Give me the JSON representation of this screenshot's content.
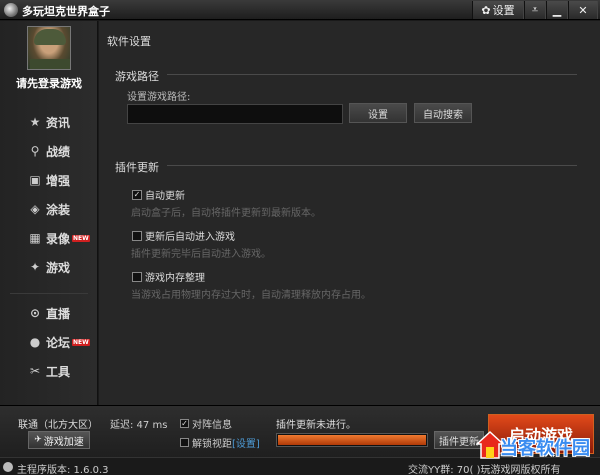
{
  "window": {
    "title": "多玩坦克世界盒子",
    "settings_label": "设置"
  },
  "sidebar": {
    "login_text": "请先登录游戏",
    "items": [
      {
        "label": "资讯",
        "icon": "star-icon",
        "glyph": "★",
        "new": false
      },
      {
        "label": "战绩",
        "icon": "search-icon",
        "glyph": "🔍",
        "new": false
      },
      {
        "label": "增强",
        "icon": "toolbox-icon",
        "glyph": "▣",
        "new": false
      },
      {
        "label": "涂装",
        "icon": "paint-icon",
        "glyph": "◈",
        "new": false
      },
      {
        "label": "录像",
        "icon": "film-icon",
        "glyph": "▦",
        "new": true
      },
      {
        "label": "游戏",
        "icon": "gamepad-icon",
        "glyph": "✦",
        "new": false
      },
      {
        "label": "直播",
        "icon": "play-circle-icon",
        "glyph": "▶",
        "new": false
      },
      {
        "label": "论坛",
        "icon": "chat-icon",
        "glyph": "●",
        "new": true
      },
      {
        "label": "工具",
        "icon": "tools-icon",
        "glyph": "✂",
        "new": false
      }
    ],
    "new_badge": "NEW"
  },
  "content": {
    "title": "软件设置",
    "game_path": {
      "section": "游戏路径",
      "label": "设置游戏路径:",
      "value": "",
      "set_button": "设置",
      "auto_search_button": "自动搜索"
    },
    "plugin_update": {
      "section": "插件更新",
      "options": [
        {
          "label": "自动更新",
          "checked": true,
          "hint": "启动盒子后，自动将插件更新到最新版本。"
        },
        {
          "label": "更新后自动进入游戏",
          "checked": false,
          "hint": "插件更新完毕后自动进入游戏。"
        },
        {
          "label": "游戏内存整理",
          "checked": false,
          "hint": "当游戏占用物理内存过大时，自动清理释放内存占用。"
        }
      ]
    }
  },
  "bottom": {
    "server": "联通（北方大区）",
    "latency": "延迟: 47 ms",
    "boost_button": "游戏加速",
    "team_info": {
      "label": "对阵信息",
      "checked": true
    },
    "unlock_view": {
      "label": "解锁视距",
      "checked": false,
      "link": "[设置]"
    },
    "plugin_status": "插件更新未进行。",
    "progress": 1.0,
    "plugin_update_button": "插件更新",
    "launch_button": "启动游戏"
  },
  "statusbar": {
    "version": "主程序版本: 1.6.0.3",
    "qq_group": "交流YY群: 70(     )玩游戏网版权所有"
  },
  "watermark": "当客软件园",
  "colors": {
    "accent": "#e24a1a",
    "link": "#4d9bd6",
    "watermark": "#3a8cf0"
  }
}
